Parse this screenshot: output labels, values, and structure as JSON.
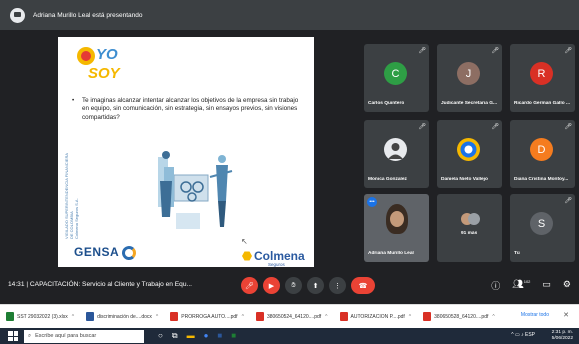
{
  "presenter_banner": {
    "text": "Adriana Murillo Leal está presentando"
  },
  "slide": {
    "logo_text": "YO SOY",
    "bullet": "Te imaginas alcanzar intentar alcanzar los objetivos de la empresa sin trabajo en equipo, sin comunicación, sin estrategia, sin ensayos previos, sin visiones compartidas?",
    "side_text": [
      "VIGILADO SUPERINTENDENCIA FINANCIERA",
      "DE COLOMBIA",
      "Colmena Seguros S.A."
    ],
    "brand_left": "GENSA",
    "brand_right": "Colmena",
    "brand_right_sub": "Seguros"
  },
  "participants": [
    {
      "name": "Carlos Quintero",
      "initial": "C",
      "color": "#2e9e45"
    },
    {
      "name": "Judicante Secretaria G...",
      "initial": "J",
      "color": "#8d6e63"
    },
    {
      "name": "Ricardo German Gallo ...",
      "initial": "R",
      "color": "#d93025"
    },
    {
      "name": "Monica Gonzalez",
      "initial": "",
      "color": ""
    },
    {
      "name": "Daniela Nieto Vallejo",
      "initial": "",
      "color": ""
    },
    {
      "name": "Diana Cristina Montoy...",
      "initial": "D",
      "color": "#f57c1f"
    },
    {
      "name": "Adriana Murillo Leal",
      "initial": "",
      "color": ""
    },
    {
      "name": "91 más",
      "initial": "",
      "color": ""
    },
    {
      "name": "Tú",
      "initial": "S",
      "color": "#5f6368"
    }
  ],
  "controls": {
    "meeting_time": "14:31",
    "meeting_title": "CAPACITACIÓN: Servicio al Cliente y Trabajo en Equ...",
    "participant_count": "102"
  },
  "downloads": [
    {
      "label": "SST 29032022 (3).xlsx",
      "color": "#1e7e34"
    },
    {
      "label": "discriminación de....docx",
      "color": "#2b579a"
    },
    {
      "label": "PRORROGA AUTO....pdf",
      "color": "#d93025"
    },
    {
      "label": "380650524_64120....pdf",
      "color": "#d93025"
    },
    {
      "label": "AUTORIZACION P....pdf",
      "color": "#d93025"
    },
    {
      "label": "380650528_64120....pdf",
      "color": "#d93025"
    }
  ],
  "downloads_show_all": "Mostrar todo",
  "taskbar": {
    "search_placeholder": "Escribe aquí para buscar",
    "language": "ESP",
    "time": "2:31 p. m.",
    "date": "5/06/2022"
  }
}
